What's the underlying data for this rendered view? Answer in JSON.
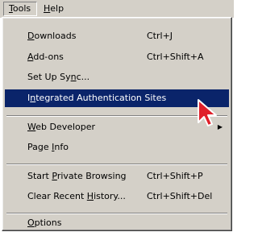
{
  "menubar": {
    "tools": {
      "prefix": "",
      "mnemonic": "T",
      "rest": "ools"
    },
    "help": {
      "prefix": "",
      "mnemonic": "H",
      "rest": "elp"
    }
  },
  "menu": {
    "items": [
      {
        "prefix": "",
        "mnemonic": "D",
        "rest": "ownloads",
        "shortcut": "Ctrl+J"
      },
      {
        "prefix": "",
        "mnemonic": "A",
        "rest": "dd-ons",
        "shortcut": "Ctrl+Shift+A"
      },
      {
        "prefix": "Set Up Sy",
        "mnemonic": "n",
        "rest": "c...",
        "shortcut": ""
      },
      {
        "prefix": "I",
        "mnemonic": "n",
        "rest": "tegrated Authentication Sites",
        "shortcut": ""
      },
      {
        "prefix": "",
        "mnemonic": "W",
        "rest": "eb Developer",
        "shortcut": ""
      },
      {
        "prefix": "Page ",
        "mnemonic": "I",
        "rest": "nfo",
        "shortcut": ""
      },
      {
        "prefix": "Start ",
        "mnemonic": "P",
        "rest": "rivate Browsing",
        "shortcut": "Ctrl+Shift+P"
      },
      {
        "prefix": "Clear Recent ",
        "mnemonic": "H",
        "rest": "istory...",
        "shortcut": "Ctrl+Shift+Del"
      },
      {
        "prefix": "",
        "mnemonic": "O",
        "rest": "ptions",
        "shortcut": ""
      }
    ],
    "submenu_arrow": "▶"
  },
  "colors": {
    "menu_bg": "#d4d0c8",
    "highlight": "#0a246a",
    "cursor": "#e0202a"
  },
  "icons": [
    "submenu-arrow-icon",
    "mouse-pointer-icon"
  ]
}
